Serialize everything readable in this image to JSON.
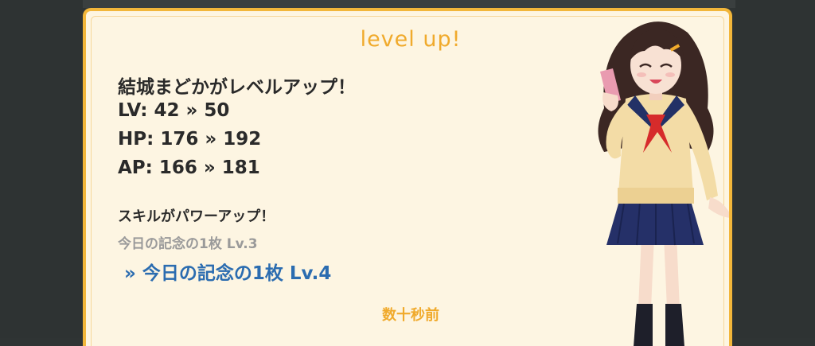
{
  "dialog": {
    "title": "level up!",
    "character_message": "結城まどかがレベルアップ！",
    "stats": {
      "lv": {
        "label": "LV:",
        "old": "42",
        "arrow": "»",
        "new": "50"
      },
      "hp": {
        "label": "HP:",
        "old": "176",
        "arrow": "»",
        "new": "192"
      },
      "ap": {
        "label": "AP:",
        "old": "166",
        "arrow": "»",
        "new": "181"
      }
    },
    "skill_message": "スキルがパワーアップ！",
    "skill_old": "今日の記念の1枚 Lv.3",
    "skill_new": "» 今日の記念の1枚 Lv.4",
    "timestamp": "数十秒前"
  },
  "colors": {
    "accent": "#f0aa2c",
    "card_bg": "#fdf5e2",
    "skill_new": "#2b6cb0",
    "backdrop": "#2f3434"
  }
}
